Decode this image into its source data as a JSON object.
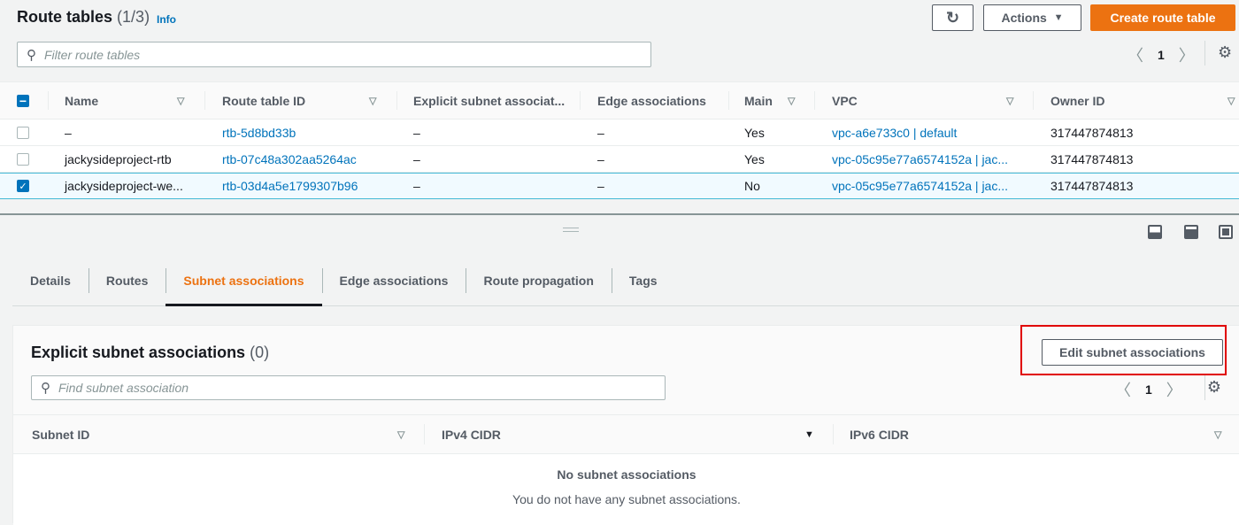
{
  "header": {
    "title": "Route tables",
    "count": "(1/3)",
    "info": "Info",
    "actions_label": "Actions",
    "create_label": "Create route table",
    "refresh_icon": "refresh-icon"
  },
  "filter": {
    "placeholder": "Filter route tables"
  },
  "pagination": {
    "page": "1"
  },
  "table": {
    "columns": [
      "Name",
      "Route table ID",
      "Explicit subnet associat...",
      "Edge associations",
      "Main",
      "VPC",
      "Owner ID"
    ],
    "rows": [
      {
        "selected": false,
        "name": "–",
        "id": "rtb-5d8bd33b",
        "explicit": "–",
        "edge": "–",
        "main": "Yes",
        "vpc": "vpc-a6e733c0 | default",
        "owner": "317447874813"
      },
      {
        "selected": false,
        "name": "jackysideproject-rtb",
        "id": "rtb-07c48a302aa5264ac",
        "explicit": "–",
        "edge": "–",
        "main": "Yes",
        "vpc": "vpc-05c95e77a6574152a | jac...",
        "owner": "317447874813"
      },
      {
        "selected": true,
        "name": "jackysideproject-we...",
        "id": "rtb-03d4a5e1799307b96",
        "explicit": "–",
        "edge": "–",
        "main": "No",
        "vpc": "vpc-05c95e77a6574152a | jac...",
        "owner": "317447874813"
      }
    ]
  },
  "tabs": [
    {
      "label": "Details"
    },
    {
      "label": "Routes"
    },
    {
      "label": "Subnet associations",
      "active": true
    },
    {
      "label": "Edge associations"
    },
    {
      "label": "Route propagation"
    },
    {
      "label": "Tags"
    }
  ],
  "panel": {
    "title": "Explicit subnet associations",
    "count": "(0)",
    "edit_label": "Edit subnet associations",
    "search_placeholder": "Find subnet association",
    "page": "1",
    "columns": [
      "Subnet ID",
      "IPv4 CIDR",
      "IPv6 CIDR"
    ],
    "empty_title": "No subnet associations",
    "empty_text": "You do not have any subnet associations."
  },
  "colors": {
    "accent": "#ec7211",
    "link": "#0073bb",
    "highlight": "#e00000"
  }
}
